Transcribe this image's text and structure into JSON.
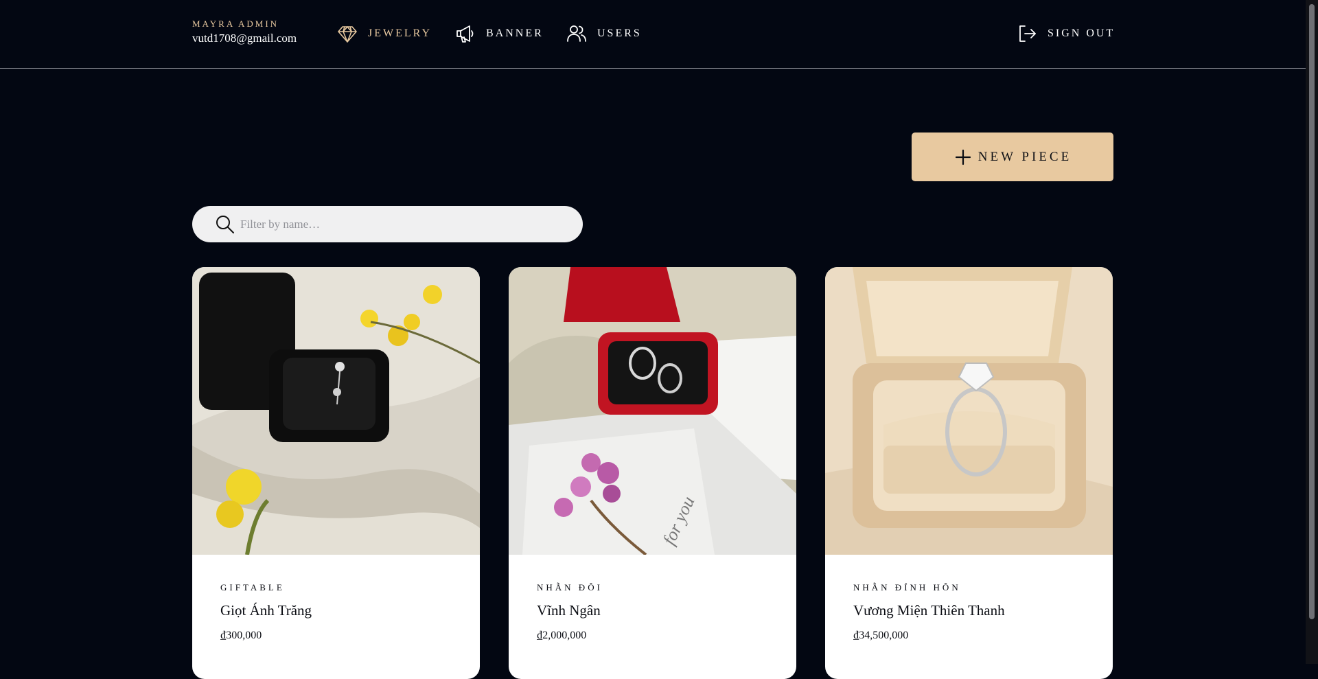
{
  "header": {
    "brand_label": "MAYRA ADMIN",
    "email": "vutd1708@gmail.com",
    "nav": {
      "jewelry": "JEWELRY",
      "banner": "BANNER",
      "users": "USERS",
      "signout": "SIGN OUT"
    }
  },
  "toolbar": {
    "new_piece_label": "NEW PIECE"
  },
  "search": {
    "placeholder": "Filter by name…",
    "value": ""
  },
  "products": [
    {
      "category": "GIFTABLE",
      "name": "Giọt Ánh Trăng",
      "price": "₫300,000"
    },
    {
      "category": "NHẪN ĐÔI",
      "name": "Vĩnh Ngân",
      "price": "₫2,000,000"
    },
    {
      "category": "NHẪN ĐÍNH HÔN",
      "name": "Vương Miện Thiên Thanh",
      "price": "₫34,500,000"
    }
  ],
  "colors": {
    "background": "#030712",
    "accent": "#e8c9a0",
    "card": "#ffffff"
  },
  "icons": {
    "jewelry": "diamond-icon",
    "banner": "megaphone-icon",
    "users": "users-icon",
    "signout": "sign-out-icon",
    "new": "plus-icon",
    "search": "search-icon"
  }
}
